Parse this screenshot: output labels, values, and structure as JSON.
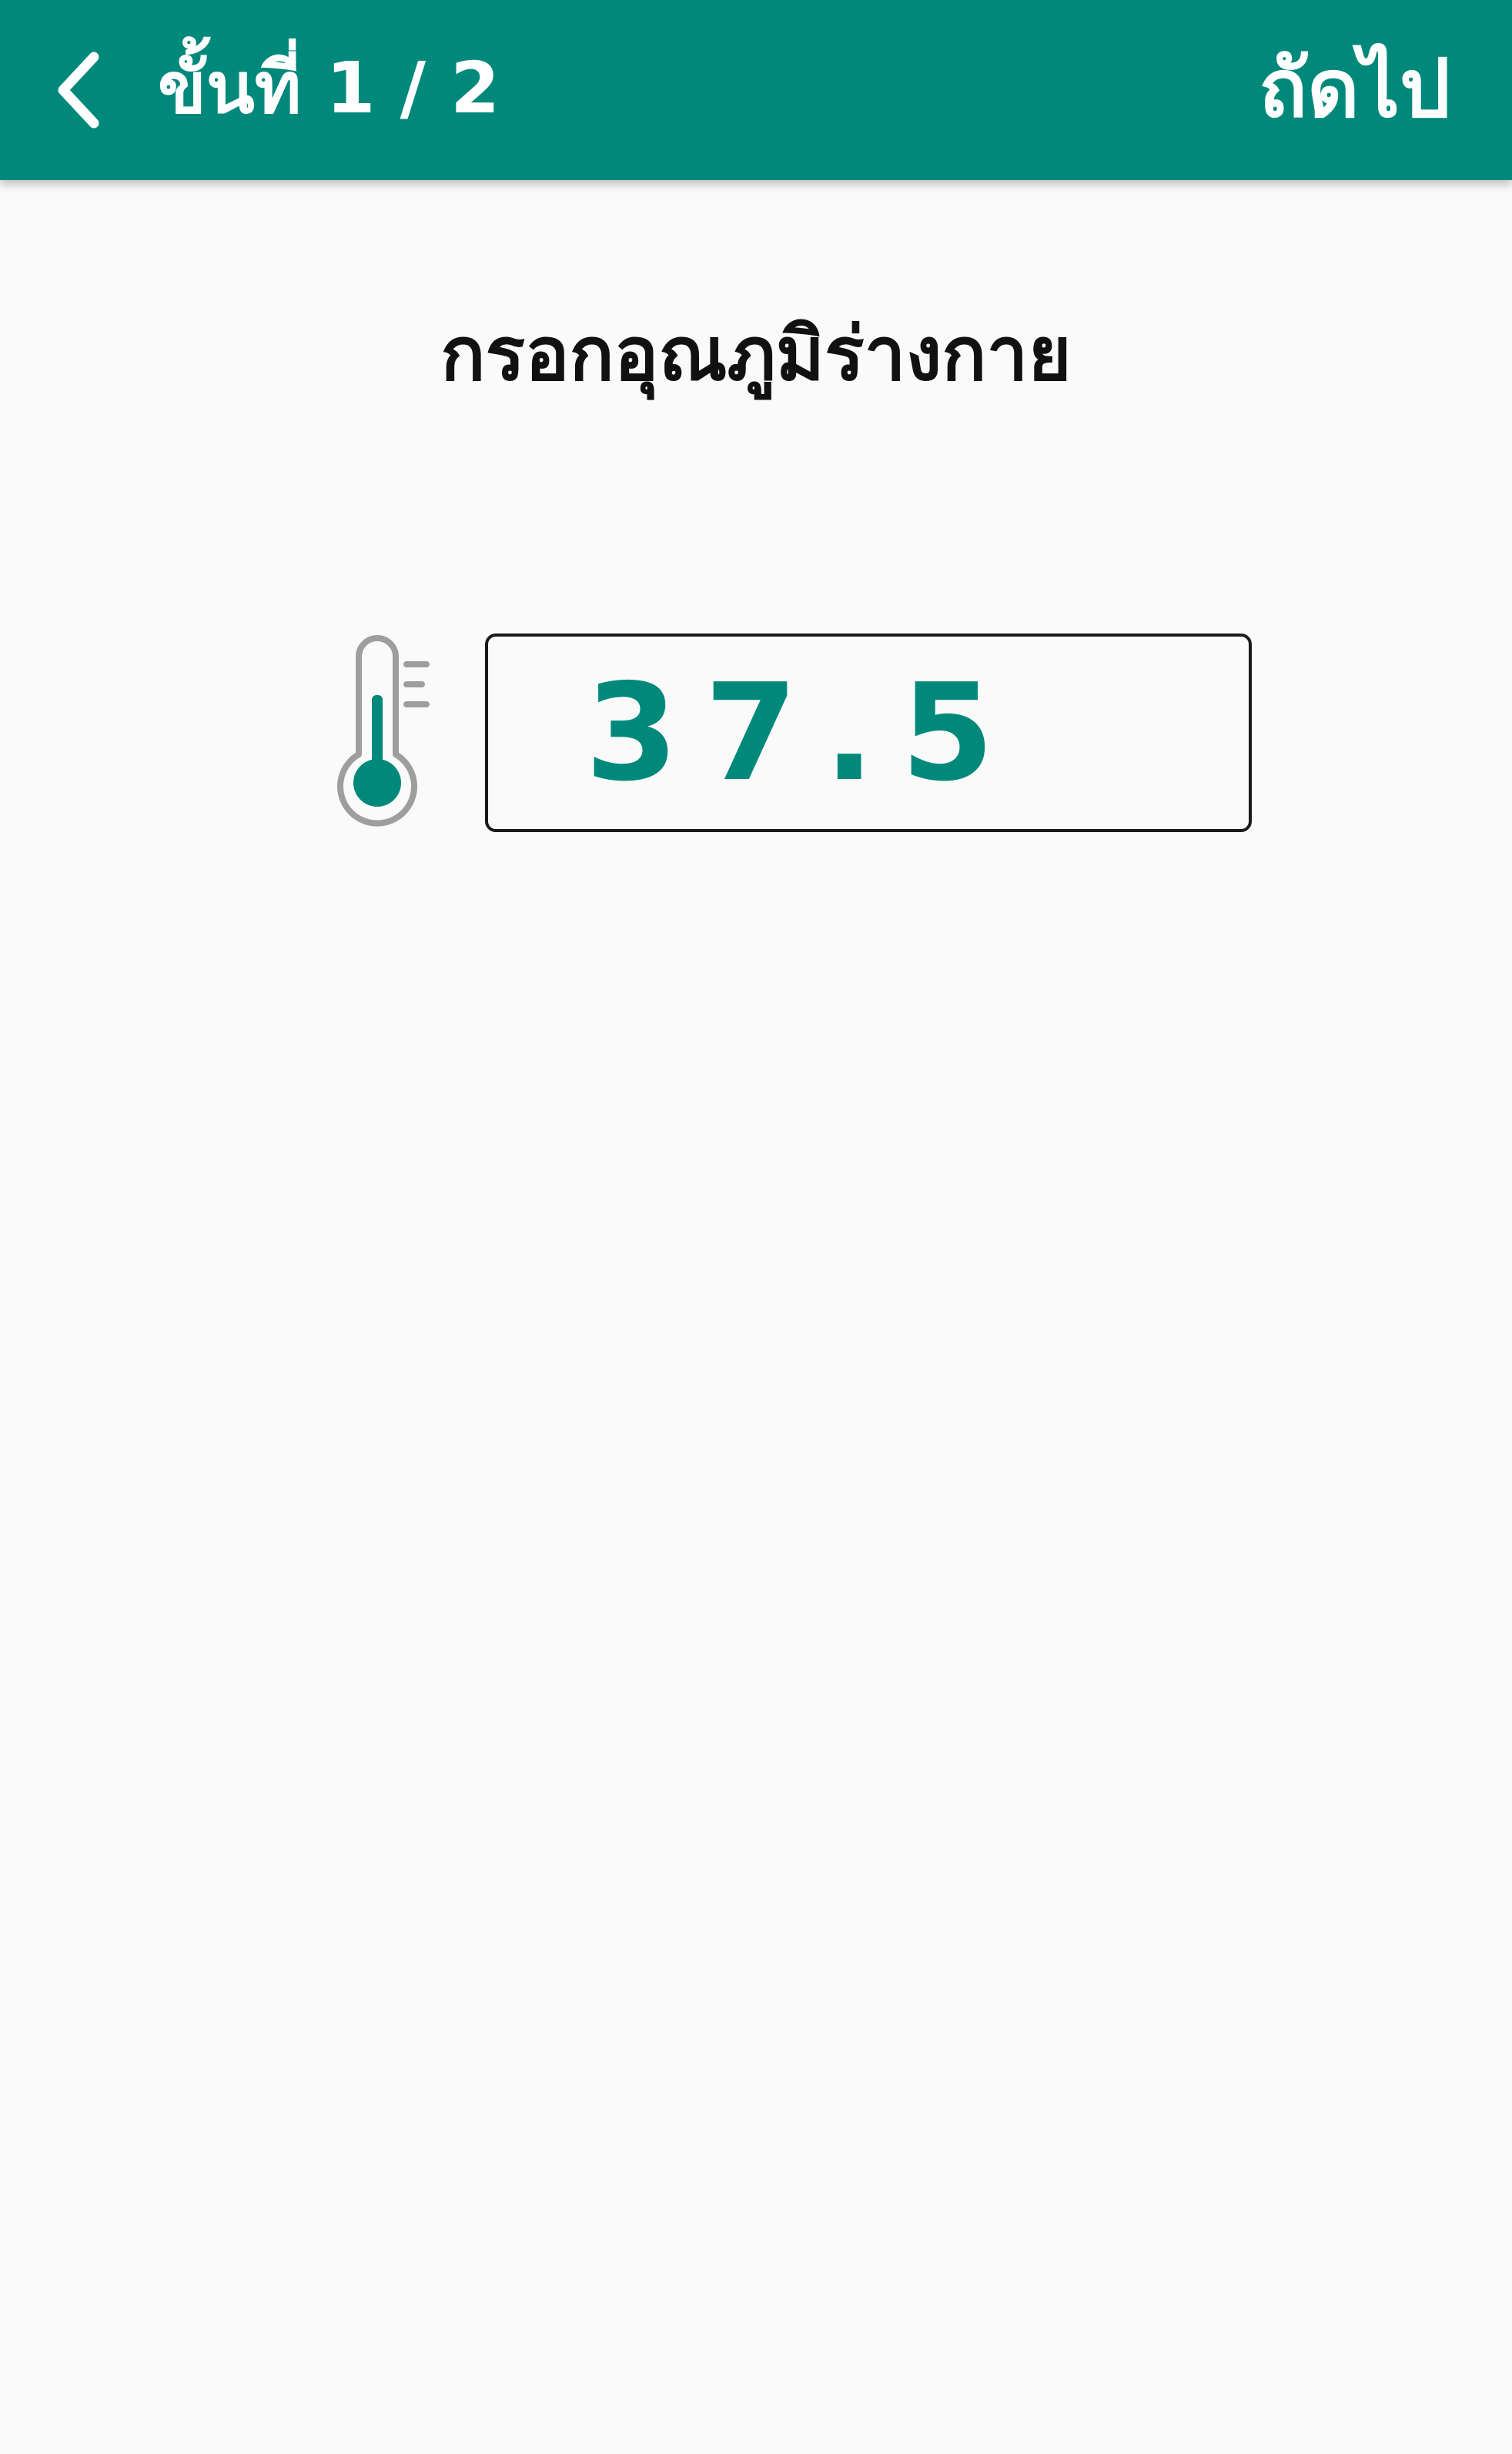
{
  "header": {
    "back_icon": "chevron-left-icon",
    "title": "ขั้นที่ 1 / 2",
    "next_label": "ถัดไป",
    "background_color": "#00897B",
    "text_color": "#FFFFFF"
  },
  "main": {
    "heading": "กรอกอุณภูมิร่างกาย",
    "thermometer_icon": "thermometer-icon",
    "temperature_input": {
      "value": "37.5"
    },
    "accent_color": "#00897B"
  }
}
